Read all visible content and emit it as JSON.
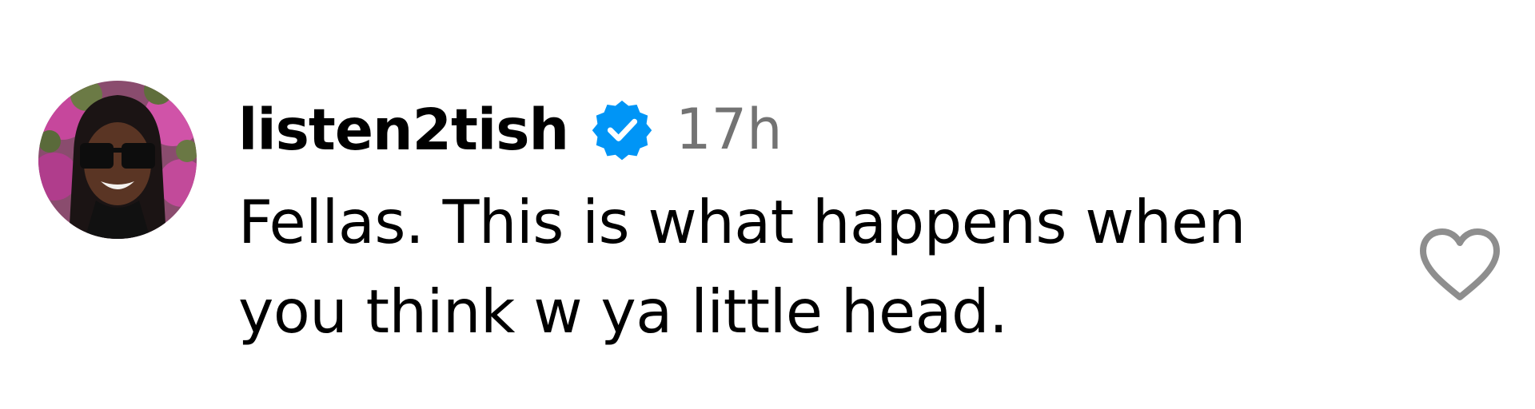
{
  "comment": {
    "username": "listen2tish",
    "verified": true,
    "time": "17h",
    "text_lines": [
      "Fellas. This is what happens when",
      "you think w ya little head."
    ],
    "avatar_icon": "user-avatar-photo",
    "verified_icon": "verified-badge-icon",
    "like_icon": "heart-outline-icon"
  },
  "colors": {
    "verified_blue": "#0095f6",
    "timestamp_gray": "#737373",
    "heart_gray": "#8e8e8e",
    "text": "#000000"
  }
}
